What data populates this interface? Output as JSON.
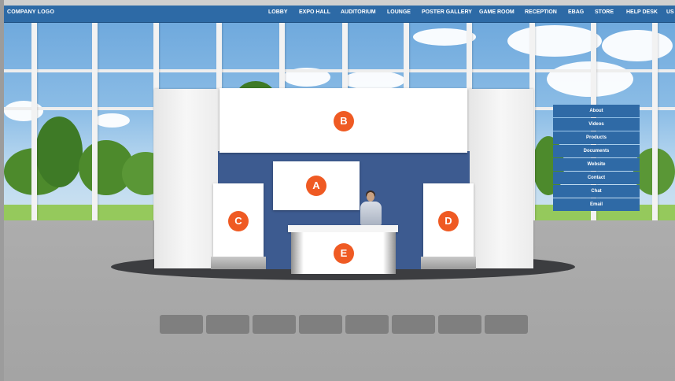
{
  "header": {
    "logo": "COMPANY LOGO",
    "nav": [
      {
        "label": "LOBBY"
      },
      {
        "label": "EXPO HALL"
      },
      {
        "label": "AUDITORIUM"
      },
      {
        "label": "LOUNGE"
      },
      {
        "label": "POSTER GALLERY"
      },
      {
        "label": "GAME ROOM"
      },
      {
        "label": "RECEPTION"
      },
      {
        "label": "EBAG"
      },
      {
        "label": "STORE"
      },
      {
        "label": "HELP DESK"
      },
      {
        "label": "US"
      }
    ]
  },
  "booth": {
    "markers": {
      "a": "A",
      "b": "B",
      "c": "C",
      "d": "D",
      "e": "E"
    }
  },
  "side_menu": [
    {
      "label": "About"
    },
    {
      "label": "Videos"
    },
    {
      "label": "Products"
    },
    {
      "label": "Documents"
    },
    {
      "label": "Website"
    },
    {
      "label": "Contact"
    },
    {
      "label": "Chat"
    },
    {
      "label": "Email"
    }
  ],
  "colors": {
    "nav_bar": "#2d6aa6",
    "marker": "#ef5a23",
    "back_wall": "#3d5b90"
  }
}
